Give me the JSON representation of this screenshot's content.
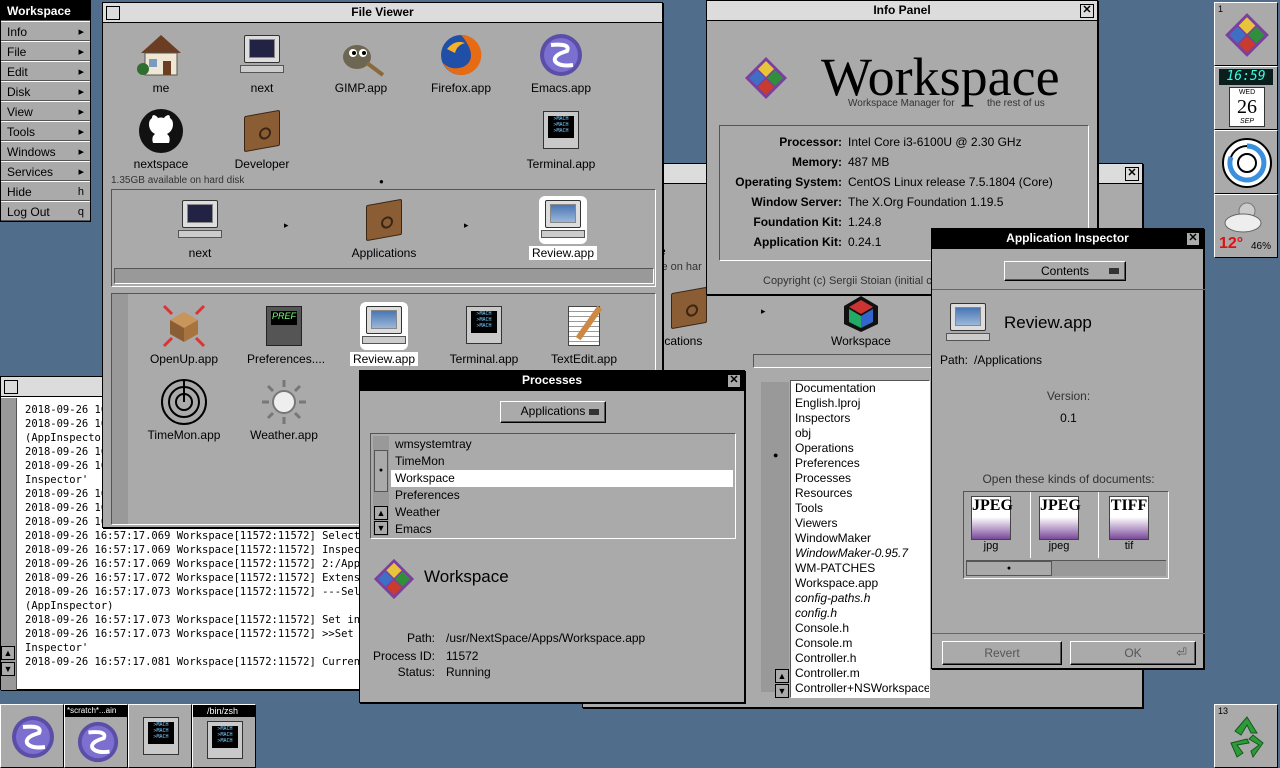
{
  "menu": {
    "title": "Workspace",
    "items": [
      {
        "label": "Info",
        "key": "▸"
      },
      {
        "label": "File",
        "key": "▸"
      },
      {
        "label": "Edit",
        "key": "▸"
      },
      {
        "label": "Disk",
        "key": "▸"
      },
      {
        "label": "View",
        "key": "▸"
      },
      {
        "label": "Tools",
        "key": "▸"
      },
      {
        "label": "Windows",
        "key": "▸"
      },
      {
        "label": "Services",
        "key": "▸"
      },
      {
        "label": "Hide",
        "key": "h"
      },
      {
        "label": "Log Out",
        "key": "q"
      }
    ]
  },
  "file_viewer": {
    "title": "File Viewer",
    "shelf": [
      "me",
      "next",
      "GIMP.app",
      "Firefox.app",
      "Emacs.app",
      "nextspace",
      "Developer",
      "Terminal.app"
    ],
    "disk_info": "1.35GB available on hard disk",
    "path": [
      "next",
      "Applications",
      "Review.app"
    ],
    "files": [
      "OpenUp.app",
      "Preferences....",
      "Review.app",
      "Terminal.app",
      "TextEdit.app",
      "TimeMon.app",
      "Weather.app"
    ]
  },
  "info_panel": {
    "title": "Info Panel",
    "app_name": "Workspace",
    "tagline_left": "Workspace Manager for",
    "tagline_right": "the rest of us",
    "rows": [
      {
        "label": "Processor:",
        "value": "Intel Core i3-6100U  @ 2.30 GHz"
      },
      {
        "label": "Memory:",
        "value": "487 MB"
      },
      {
        "label": "Operating System:",
        "value": "CentOS Linux release 7.5.1804 (Core)"
      },
      {
        "label": "Window Server:",
        "value": "The X.Org Foundation 1.19.5"
      },
      {
        "label": "Foundation Kit:",
        "value": "1.24.8"
      },
      {
        "label": "Application Kit:",
        "value": "0.24.1"
      }
    ],
    "copyright": "Copyright (c) Sergii Stoian (initial c"
  },
  "back_viewer": {
    "fragment_e": "e",
    "fragment_disk": "le on har",
    "path_left": "lications",
    "path_right": "Workspace",
    "list": [
      {
        "t": "Documentation",
        "i": false
      },
      {
        "t": "English.lproj",
        "i": false
      },
      {
        "t": "Inspectors",
        "i": false
      },
      {
        "t": "obj",
        "i": false
      },
      {
        "t": "Operations",
        "i": false
      },
      {
        "t": "Preferences",
        "i": false
      },
      {
        "t": "Processes",
        "i": false
      },
      {
        "t": "Resources",
        "i": false
      },
      {
        "t": "Tools",
        "i": false
      },
      {
        "t": "Viewers",
        "i": false
      },
      {
        "t": "WindowMaker",
        "i": false
      },
      {
        "t": "WindowMaker-0.95.7",
        "i": true
      },
      {
        "t": "WM-PATCHES",
        "i": false
      },
      {
        "t": "Workspace.app",
        "i": false
      },
      {
        "t": "config-paths.h",
        "i": true
      },
      {
        "t": "config.h",
        "i": true
      },
      {
        "t": "Console.h",
        "i": false
      },
      {
        "t": "Console.m",
        "i": false
      },
      {
        "t": "Controller.h",
        "i": false
      },
      {
        "t": "Controller.m",
        "i": false
      },
      {
        "t": "Controller+NSWorkspace...",
        "i": false
      }
    ],
    "selected_index": 13
  },
  "app_inspector": {
    "title": "Application Inspector",
    "popup": "Contents",
    "app": "Review.app",
    "path_label": "Path:",
    "path": "/Applications",
    "version_label": "Version:",
    "version": "0.1",
    "docs_label": "Open these kinds of documents:",
    "docs": [
      {
        "type": "JPEG",
        "ext": "jpg"
      },
      {
        "type": "JPEG",
        "ext": "jpeg"
      },
      {
        "type": "TIFF",
        "ext": "tif"
      }
    ],
    "revert": "Revert",
    "ok": "OK"
  },
  "processes": {
    "title": "Processes",
    "popup": "Applications",
    "list": [
      "wmsystemtray",
      "TimeMon",
      "Workspace",
      "Preferences",
      "Weather",
      "Emacs"
    ],
    "selected_index": 2,
    "app": "Workspace",
    "path_label": "Path:",
    "path": "/usr/NextSpace/Apps/Workspace.app",
    "pid_label": "Process ID:",
    "pid": "11572",
    "status_label": "Status:",
    "status": "Running"
  },
  "console": {
    "lines": [
      "2018-09-26 16",
      "2018-09-26 16",
      "(AppInspector",
      "2018-09-26 16",
      "2018-09-26 16",
      "Inspector'",
      "2018-09-26 16",
      "2018-09-26 16",
      "2018-09-26 16",
      "2018-09-26 16:57:17.069 Workspace[11572:11572] Selectio",
      "2018-09-26 16:57:17.069 Workspace[11572:11572] Inspector",
      "2018-09-26 16:57:17.069 Workspace[11572:11572] 2:/Applic",
      "2018-09-26 16:57:17.072 Workspace[11572:11572] Extension",
      "2018-09-26 16:57:17.073 Workspace[11572:11572] ---Select",
      "(AppInspector)",
      "2018-09-26 16:57:17.073 Workspace[11572:11572] Set inspe",
      "2018-09-26 16:57:17.073 Workspace[11572:11572] >>Set ins",
      "Inspector'",
      "2018-09-26 16:57:17.081 Workspace[11572:11572] Current i"
    ]
  },
  "dock": {
    "workspace_num": "1",
    "clock_time": "16:59",
    "clock_day": "WED",
    "clock_date": "26",
    "clock_month": "SEP",
    "weather_temp": "12°",
    "weather_humidity": "46%",
    "recycler_num": "13"
  },
  "taskbar": {
    "scratch_title": "*scratch*...ain",
    "zsh_title": "/bin/zsh"
  }
}
